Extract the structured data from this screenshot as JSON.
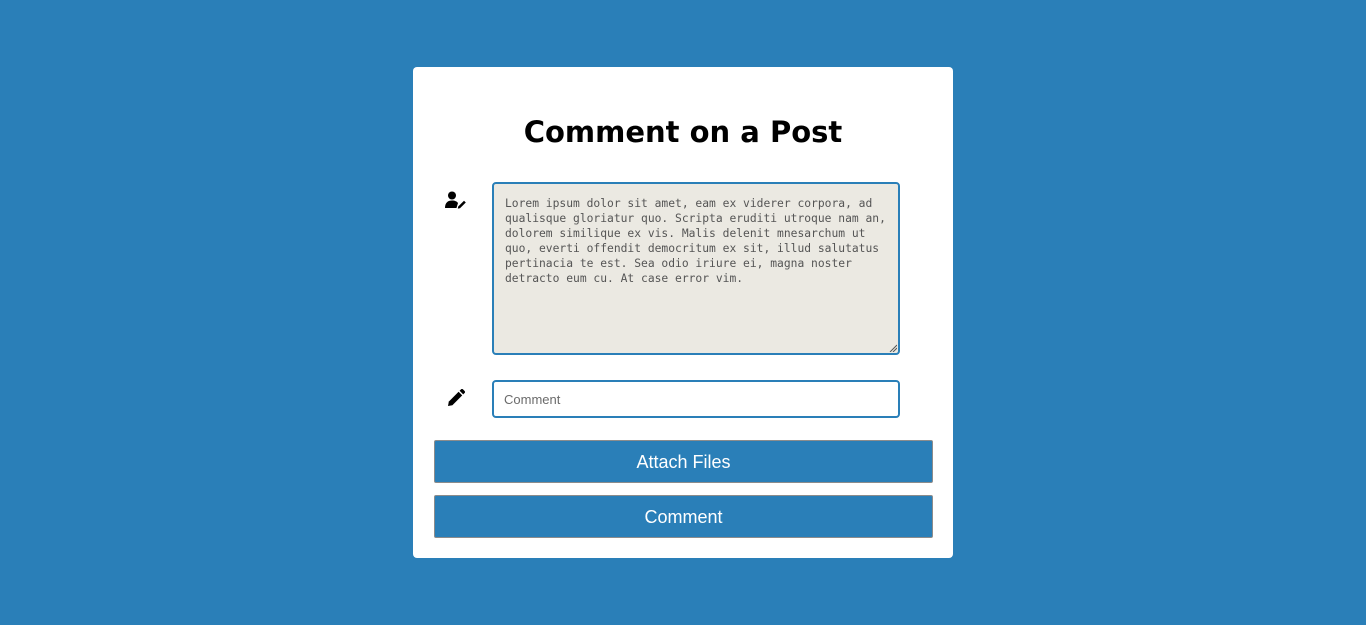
{
  "page": {
    "background_color": "#2a7fb8",
    "card_color": "#ffffff"
  },
  "form": {
    "title": "Comment on a Post",
    "post_icon": "user-pen-icon",
    "post_text": "Lorem ipsum dolor sit amet, eam ex viderer corpora, ad qualisque gloriatur quo. Scripta eruditi utroque nam an, dolorem similique ex vis. Malis delenit mnesarchum ut quo, everti offendit democritum ex sit, illud salutatus pertinacia te est. Sea odio iriure ei, magna noster detracto eum cu. At case error vim.",
    "comment_icon": "pencil-icon",
    "comment_placeholder": "Comment",
    "comment_value": "",
    "attach_label": "Attach Files",
    "submit_label": "Comment"
  }
}
